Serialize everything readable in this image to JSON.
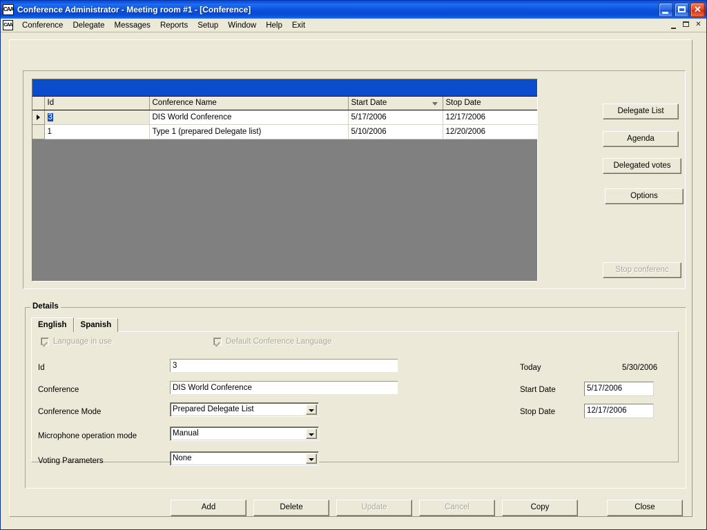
{
  "window": {
    "title": "Conference Administrator - Meeting room #1 - [Conference]",
    "app_icon": "CAA",
    "minimize_label": "",
    "maximize_label": "",
    "close_label": "✕"
  },
  "menu": {
    "icon": "CAA",
    "items": [
      {
        "label": "Conference"
      },
      {
        "label": "Delegate"
      },
      {
        "label": "Messages"
      },
      {
        "label": "Reports"
      },
      {
        "label": "Setup"
      },
      {
        "label": "Window"
      },
      {
        "label": "Help"
      },
      {
        "label": "Exit"
      }
    ],
    "mdi_minimize": "_",
    "mdi_restore": "",
    "mdi_close": "✕"
  },
  "grid": {
    "columns": [
      {
        "label": "Id",
        "sorted": false
      },
      {
        "label": "Conference Name",
        "sorted": false
      },
      {
        "label": "Start Date",
        "sorted": true,
        "sort_dir": "desc"
      },
      {
        "label": "Stop Date",
        "sorted": false
      }
    ],
    "rows": [
      {
        "selected": true,
        "id": "3",
        "name": "DIS World Conference",
        "start": "5/17/2006",
        "stop": "12/17/2006"
      },
      {
        "selected": false,
        "id": "1",
        "name": "Type 1 (prepared Delegate list)",
        "start": "5/10/2006",
        "stop": "12/20/2006"
      }
    ]
  },
  "side_buttons": [
    {
      "label": "Delegate List",
      "enabled": true
    },
    {
      "label": "Agenda",
      "enabled": true
    },
    {
      "label": "Delegated votes",
      "enabled": true
    },
    {
      "label": "Options",
      "enabled": true
    },
    {
      "label": "Stop conferenc",
      "enabled": false
    }
  ],
  "details": {
    "legend": "Details",
    "tabs": [
      {
        "label": "English",
        "active": true
      },
      {
        "label": "Spanish",
        "active": false
      }
    ],
    "checkboxes": [
      {
        "label": "Language in use",
        "checked": true,
        "enabled": false
      },
      {
        "label": "Default Conference Language",
        "checked": true,
        "enabled": false
      }
    ],
    "fields": {
      "id": {
        "label": "Id",
        "value": "3"
      },
      "conference": {
        "label": "Conference",
        "value": "DIS World Conference"
      },
      "conference_mode": {
        "label": "Conference Mode",
        "value": "Prepared Delegate List"
      },
      "microphone_mode": {
        "label": "Microphone operation mode",
        "value": "Manual"
      },
      "voting_parameters": {
        "label": "Voting Parameters",
        "value": "None"
      }
    },
    "dates": {
      "today": {
        "label": "Today",
        "value": "5/30/2006"
      },
      "start_date": {
        "label": "Start Date",
        "value": "5/17/2006"
      },
      "stop_date": {
        "label": "Stop Date",
        "value": "12/17/2006"
      }
    }
  },
  "bottom_buttons": [
    {
      "label": "Add",
      "enabled": true
    },
    {
      "label": "Delete",
      "enabled": true
    },
    {
      "label": "Update",
      "enabled": false
    },
    {
      "label": "Cancel",
      "enabled": false
    },
    {
      "label": "Copy",
      "enabled": true
    },
    {
      "label": "Close",
      "enabled": true
    }
  ],
  "colors": {
    "face": "#ece9d8",
    "accent_blue": "#0a4ccc",
    "title_blue": "#0a52e0",
    "grid_empty": "#808080",
    "disabled_text": "#aca899"
  }
}
